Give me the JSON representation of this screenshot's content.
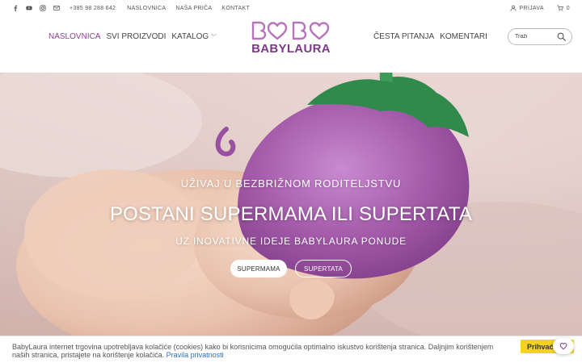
{
  "topbar": {
    "phone": "+385 98 288 642",
    "links": [
      "NASLOVNICA",
      "NAŠA PRIČA",
      "KONTAKT"
    ],
    "login": "PRIJAVA",
    "cart_count": "0",
    "icons": [
      "facebook-icon",
      "youtube-icon",
      "instagram-icon",
      "mail-icon",
      "user-icon",
      "cart-icon"
    ]
  },
  "nav": {
    "left": [
      "NASLOVNICA",
      "SVI PROIZVODI",
      "KATALOG"
    ],
    "right": [
      "ČESTA PITANJA",
      "KOMENTARI"
    ]
  },
  "logo": {
    "text": "BABYLAURA",
    "mark": "BABY"
  },
  "search": {
    "placeholder": "Traži"
  },
  "hero": {
    "kicker": "UŽIVAJ U BEZBRIŽNOM RODITELJSTVU",
    "headline": "POSTANI SUPERMAMA ILI SUPERTATA",
    "sub": "UZ INOVATIVNE IDEJE BABYLAURA PONUDE",
    "buttons": [
      "SUPERMAMA",
      "SUPERTATA"
    ]
  },
  "cookie": {
    "message": "BabyLaura internet trgovina upotrebljava kolačiće (cookies) kako bi korisnicima omogućila optimalno iskustvo korištenja stranica. Daljnjim korištenjem naših stranica, pristajete na korištenje kolačića.",
    "link": "Pravila privatnosti",
    "accept": "Prihvaća"
  },
  "colors": {
    "brand_purple": "#7b3a86",
    "accent_active": "#8a3f8f",
    "cookie_button": "#f5d31b",
    "link_blue": "#2c6fb7"
  }
}
